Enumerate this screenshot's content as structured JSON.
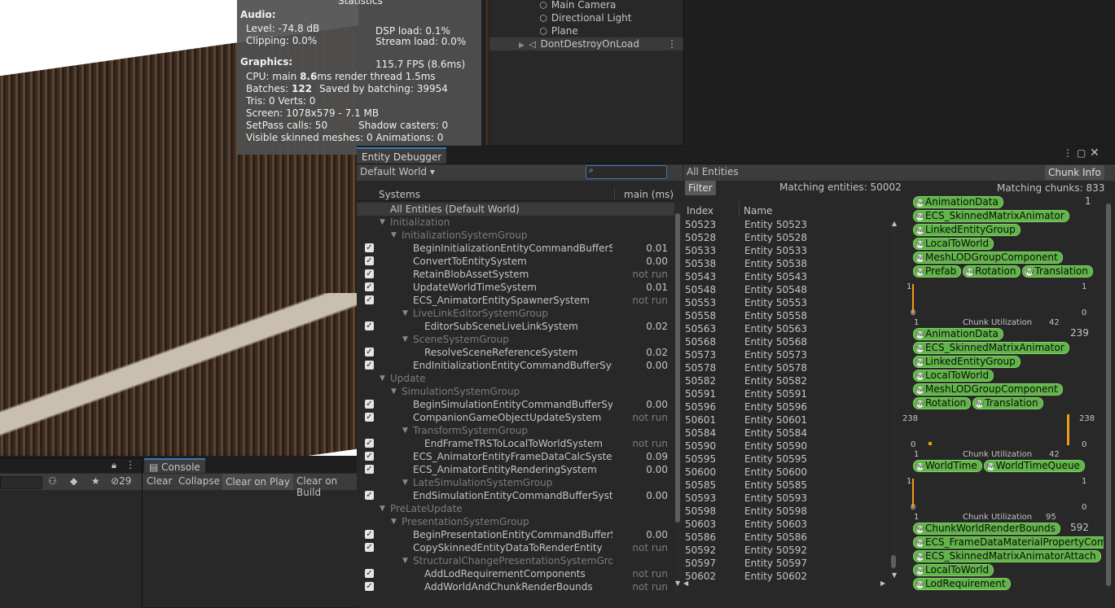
{
  "stats": {
    "title": "Statistics",
    "audio_header": "Audio:",
    "level": "Level: -74.8 dB",
    "clipping": "Clipping: 0.0%",
    "dsp": "DSP load: 0.1%",
    "stream": "Stream load: 0.0%",
    "graphics_header": "Graphics:",
    "fps": "115.7 FPS (8.6ms)",
    "cpu_prefix": "CPU: main ",
    "cpu_main": "8.6",
    "cpu_suffix": "ms  render thread 1.5ms",
    "batches_prefix": "Batches: ",
    "batches": "122",
    "saved": "Saved by batching: 39954",
    "tris": "Tris: 0   Verts: 0",
    "screen": "Screen: 1078x579 - 7.1 MB",
    "setpass": "SetPass calls: 50",
    "shadow": "Shadow casters: 0",
    "skinned": "Visible skinned meshes: 0  Animations: 0"
  },
  "hierarchy": {
    "items": [
      {
        "label": "Main Camera",
        "icon": "gameobject-icon"
      },
      {
        "label": "Directional Light",
        "icon": "gameobject-icon"
      },
      {
        "label": "Plane",
        "icon": "gameobject-icon"
      },
      {
        "label": "DontDestroyOnLoad",
        "icon": "unity-scene-icon"
      }
    ]
  },
  "console": {
    "tab": "Console",
    "buttons": [
      "Clear",
      "Collapse",
      "Clear on Play",
      "Clear on Build"
    ],
    "project_count": "29"
  },
  "debugger": {
    "tab": "Entity Debugger",
    "world": "Default World",
    "systems_header": "Systems",
    "time_header": "main (ms)",
    "all_entities_default": "All Entities (Default World)",
    "systems": [
      {
        "label": "Initialization",
        "type": "group",
        "time": ""
      },
      {
        "label": "InitializationSystemGroup",
        "type": "group",
        "time": ""
      },
      {
        "label": "BeginInitializationEntityCommandBufferSyst",
        "type": "sys",
        "time": "0.01"
      },
      {
        "label": "ConvertToEntitySystem",
        "type": "sys",
        "time": "0.00"
      },
      {
        "label": "RetainBlobAssetSystem",
        "type": "sys",
        "time": "not run"
      },
      {
        "label": "UpdateWorldTimeSystem",
        "type": "sys",
        "time": "0.01"
      },
      {
        "label": "ECS_AnimatorEntitySpawnerSystem",
        "type": "sys",
        "time": "not run"
      },
      {
        "label": "LiveLinkEditorSystemGroup",
        "type": "group",
        "time": ""
      },
      {
        "label": "EditorSubSceneLiveLinkSystem",
        "type": "sys",
        "time": "0.02"
      },
      {
        "label": "SceneSystemGroup",
        "type": "group",
        "time": ""
      },
      {
        "label": "ResolveSceneReferenceSystem",
        "type": "sys",
        "time": "0.02"
      },
      {
        "label": "EndInitializationEntityCommandBufferSyster",
        "type": "sys",
        "time": "0.00"
      },
      {
        "label": "Update",
        "type": "group",
        "time": ""
      },
      {
        "label": "SimulationSystemGroup",
        "type": "group",
        "time": ""
      },
      {
        "label": "BeginSimulationEntityCommandBufferSyste",
        "type": "sys",
        "time": "0.00"
      },
      {
        "label": "CompanionGameObjectUpdateSystem",
        "type": "sys",
        "time": "not run"
      },
      {
        "label": "TransformSystemGroup",
        "type": "group",
        "time": ""
      },
      {
        "label": "EndFrameTRSToLocalToWorldSystem",
        "type": "sys",
        "time": "not run"
      },
      {
        "label": "ECS_AnimatorEntityFrameDataCalcSystem",
        "type": "sys",
        "time": "0.09"
      },
      {
        "label": "ECS_AnimatorEntityRenderingSystem",
        "type": "sys",
        "time": "0.00"
      },
      {
        "label": "LateSimulationSystemGroup",
        "type": "group",
        "time": ""
      },
      {
        "label": "EndSimulationEntityCommandBufferSystem",
        "type": "sys",
        "time": "0.00"
      },
      {
        "label": "PreLateUpdate",
        "type": "group",
        "time": ""
      },
      {
        "label": "PresentationSystemGroup",
        "type": "group",
        "time": ""
      },
      {
        "label": "BeginPresentationEntityCommandBufferSys",
        "type": "sys",
        "time": "0.00"
      },
      {
        "label": "CopySkinnedEntityDataToRenderEntity",
        "type": "sys",
        "time": "not run"
      },
      {
        "label": "StructuralChangePresentationSystemGroup",
        "type": "group",
        "time": ""
      },
      {
        "label": "AddLodRequirementComponents",
        "type": "sys",
        "time": "not run"
      },
      {
        "label": "AddWorldAndChunkRenderBounds",
        "type": "sys",
        "time": "not run"
      }
    ],
    "all_entities_label": "All Entities",
    "chunk_info": "Chunk Info",
    "filter": "Filter",
    "matching_entities": "Matching entities: 50002",
    "matching_chunks": "Matching chunks: 833",
    "col_index": "Index",
    "col_name": "Name",
    "entities": [
      {
        "index": "50523",
        "name": "Entity 50523"
      },
      {
        "index": "50528",
        "name": "Entity 50528"
      },
      {
        "index": "50533",
        "name": "Entity 50533"
      },
      {
        "index": "50538",
        "name": "Entity 50538"
      },
      {
        "index": "50543",
        "name": "Entity 50543"
      },
      {
        "index": "50548",
        "name": "Entity 50548"
      },
      {
        "index": "50553",
        "name": "Entity 50553"
      },
      {
        "index": "50558",
        "name": "Entity 50558"
      },
      {
        "index": "50563",
        "name": "Entity 50563"
      },
      {
        "index": "50568",
        "name": "Entity 50568"
      },
      {
        "index": "50573",
        "name": "Entity 50573"
      },
      {
        "index": "50578",
        "name": "Entity 50578"
      },
      {
        "index": "50582",
        "name": "Entity 50582"
      },
      {
        "index": "50591",
        "name": "Entity 50591"
      },
      {
        "index": "50596",
        "name": "Entity 50596"
      },
      {
        "index": "50601",
        "name": "Entity 50601"
      },
      {
        "index": "50584",
        "name": "Entity 50584"
      },
      {
        "index": "50590",
        "name": "Entity 50590"
      },
      {
        "index": "50595",
        "name": "Entity 50595"
      },
      {
        "index": "50600",
        "name": "Entity 50600"
      },
      {
        "index": "50585",
        "name": "Entity 50585"
      },
      {
        "index": "50593",
        "name": "Entity 50593"
      },
      {
        "index": "50598",
        "name": "Entity 50598"
      },
      {
        "index": "50603",
        "name": "Entity 50603"
      },
      {
        "index": "50586",
        "name": "Entity 50586"
      },
      {
        "index": "50592",
        "name": "Entity 50592"
      },
      {
        "index": "50597",
        "name": "Entity 50597"
      },
      {
        "index": "50602",
        "name": "Entity 50602"
      }
    ],
    "archetypes": [
      {
        "count": "1",
        "components": [
          [
            "AnimationData"
          ],
          [
            "ECS_SkinnedMatrixAnimator"
          ],
          [
            "LinkedEntityGroup"
          ],
          [
            "LocalToWorld"
          ],
          [
            "MeshLODGroupComponent"
          ],
          [
            "Prefab",
            "Rotation",
            "Translation"
          ]
        ],
        "chart": {
          "left_top": "1",
          "left_bottom": "0",
          "right_top": "1",
          "right_bottom": "0",
          "x_min": "1",
          "x_max": "42",
          "label": "Chunk Utilization"
        }
      },
      {
        "count": "239",
        "components": [
          [
            "AnimationData"
          ],
          [
            "ECS_SkinnedMatrixAnimator"
          ],
          [
            "LinkedEntityGroup"
          ],
          [
            "LocalToWorld"
          ],
          [
            "MeshLODGroupComponent"
          ],
          [
            "Rotation",
            "Translation"
          ]
        ],
        "chart": {
          "left_top": "238",
          "left_bottom": "0",
          "right_top": "238",
          "right_bottom": "0",
          "x_min": "1",
          "x_max": "42",
          "label": "Chunk Utilization"
        }
      },
      {
        "count": "",
        "components": [
          [
            "WorldTime",
            "WorldTimeQueue"
          ]
        ],
        "chart": {
          "left_top": "1",
          "left_bottom": "0",
          "right_top": "1",
          "right_bottom": "0",
          "x_min": "1",
          "x_max": "95",
          "label": "Chunk Utilization"
        }
      },
      {
        "count": "592",
        "components": [
          [
            "ChunkWorldRenderBounds"
          ],
          [
            "ECS_FrameDataMaterialPropertyCom"
          ],
          [
            "ECS_SkinnedMatrixAnimatorAttach"
          ],
          [
            "LocalToWorld"
          ],
          [
            "LodRequirement"
          ]
        ],
        "chart": null
      }
    ]
  }
}
